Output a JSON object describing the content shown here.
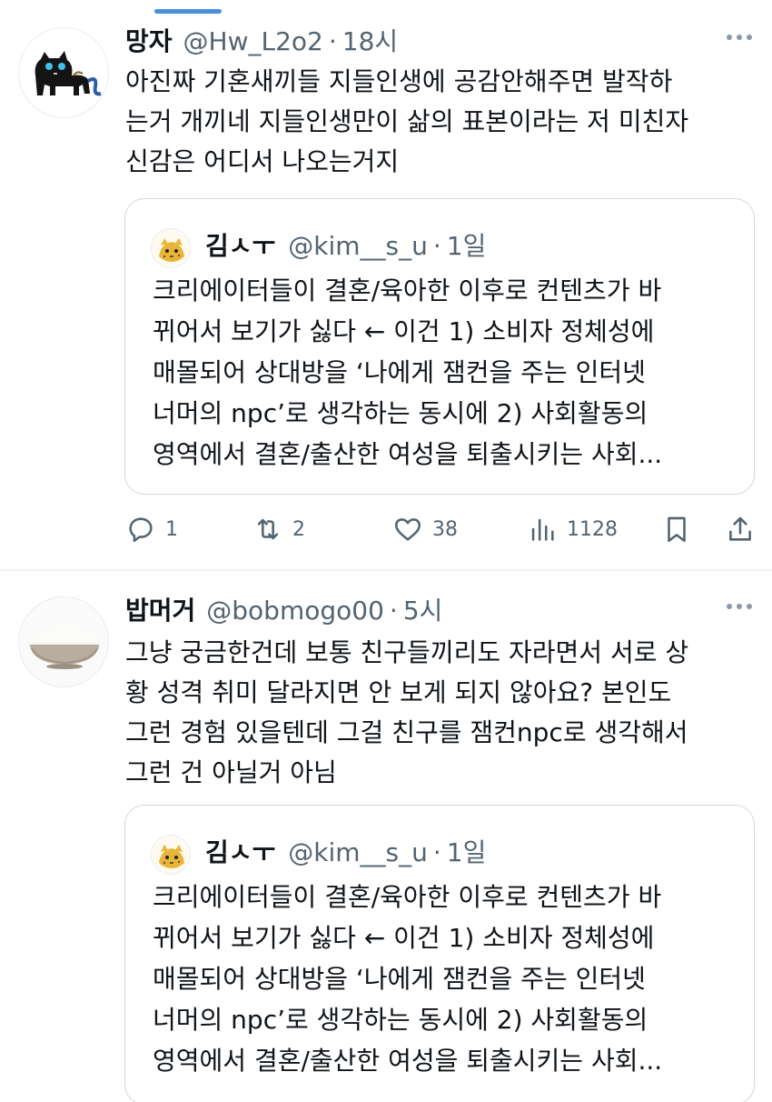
{
  "tweets": [
    {
      "author_name": "망자",
      "handle": "@Hw_L2o2",
      "separator": "·",
      "time": "18시",
      "text_lines": [
        "아진짜 기혼새끼들 지들인생에 공감안해주면 발작하",
        "는거 개끼네 지들인생만이 삶의 표본이라는 저 미친자",
        "신감은 어디서 나오는거지"
      ],
      "quote": {
        "author_name": "김ㅅㅜ",
        "handle": "@kim__s_u",
        "separator": "·",
        "time": "1일",
        "text_lines": [
          "크리에이터들이 결혼/육아한 이후로 컨텐츠가 바",
          "뀌어서 보기가 싫다 ← 이건 1) 소비자 정체성에",
          "매몰되어 상대방을 ‘나에게 잼컨을 주는 인터넷",
          "너머의 npc’로 생각하는 동시에 2) 사회활동의",
          "영역에서 결혼/출산한 여성을 퇴출시키는 사회..."
        ]
      },
      "actions": {
        "replies": "1",
        "retweets": "2",
        "likes": "38",
        "views": "1128"
      }
    },
    {
      "author_name": "밥머거",
      "handle": "@bobmogo00",
      "separator": "·",
      "time": "5시",
      "text_lines": [
        "그냥 궁금한건데 보통 친구들끼리도 자라면서 서로 상",
        "황 성격 취미 달라지면 안 보게 되지 않아요? 본인도",
        "그런 경험 있을텐데 그걸 친구를 잼컨npc로 생각해서",
        "그런 건 아닐거 아님"
      ],
      "quote": {
        "author_name": "김ㅅㅜ",
        "handle": "@kim__s_u",
        "separator": "·",
        "time": "1일",
        "text_lines": [
          "크리에이터들이 결혼/육아한 이후로 컨텐츠가 바",
          "뀌어서 보기가 싫다 ← 이건 1) 소비자 정체성에",
          "매몰되어 상대방을 ‘나에게 잼컨을 주는 인터넷",
          "너머의 npc’로 생각하는 동시에 2) 사회활동의",
          "영역에서 결혼/출산한 여성을 퇴출시키는 사회..."
        ]
      }
    }
  ],
  "icons": {
    "reply": "reply-icon",
    "retweet": "retweet-icon",
    "like": "heart-icon",
    "views": "views-icon",
    "bookmark": "bookmark-icon",
    "share": "share-icon",
    "more": "more-icon"
  },
  "colors": {
    "text": "#0f1419",
    "secondary": "#536471",
    "border": "#cfd9de",
    "accent": "#4a90d9"
  }
}
